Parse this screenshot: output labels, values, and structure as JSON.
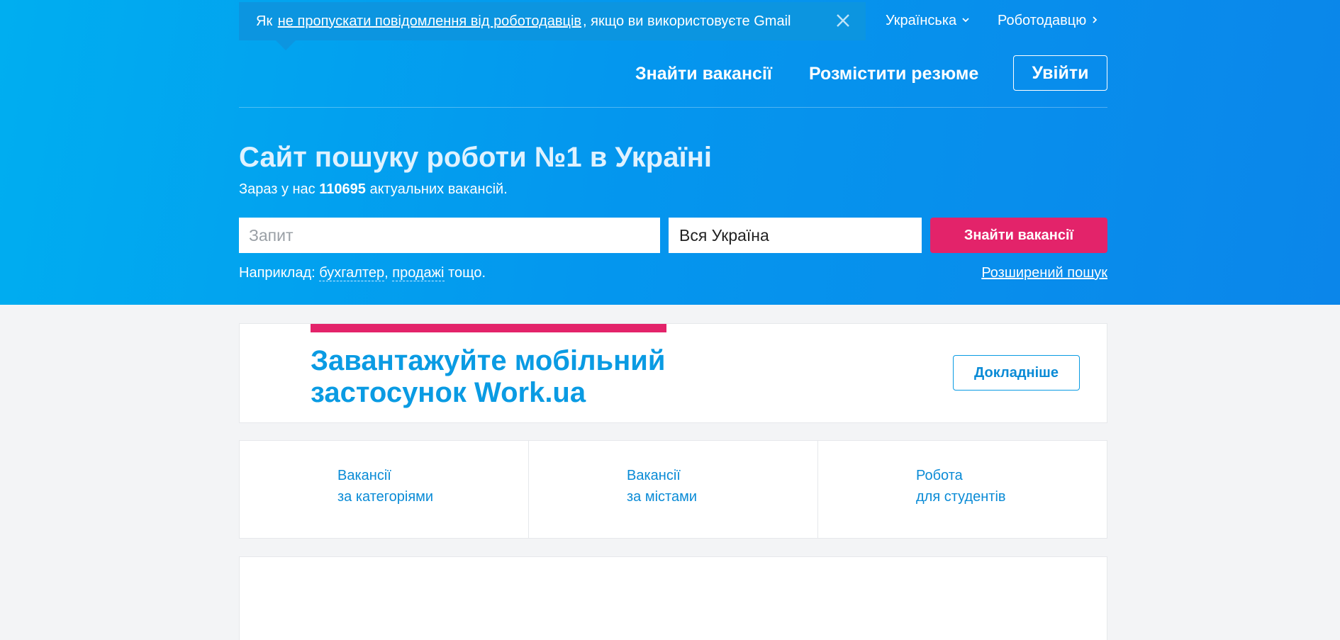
{
  "notice": {
    "prefix": "Як",
    "link": "не пропускати повідомлення від роботодавців",
    "suffix": ", якщо ви використовуєте Gmail"
  },
  "header": {
    "language": "Українська",
    "employer": "Роботодавцю",
    "nav": {
      "find_jobs": "Знайти вакансії",
      "post_resume": "Розмістити резюме",
      "login": "Увійти"
    }
  },
  "hero": {
    "title": "Сайт пошуку роботи №1 в Україні",
    "subtitle_prefix": "Зараз у нас",
    "vacancy_count": "110695",
    "subtitle_suffix": "актуальних вакансій."
  },
  "search": {
    "query_placeholder": "Запит",
    "region_value": "Вся Україна",
    "button": "Знайти вакансії",
    "examples_prefix": "Наприклад:",
    "example1": "бухгалтер",
    "example2": "продажі",
    "examples_suffix": "тощо.",
    "advanced": "Розширений пошук"
  },
  "promo": {
    "title": "Завантажуйте мобільний застосунок Work.ua",
    "button": "Докладніше"
  },
  "categories": [
    {
      "line1": "Вакансії",
      "line2": "за категоріями"
    },
    {
      "line1": "Вакансії",
      "line2": "за містами"
    },
    {
      "line1": "Робота",
      "line2": "для студентів"
    }
  ],
  "colors": {
    "accent": "#e3236a",
    "brand_blue": "#0a9be3",
    "hero_start": "#00aef0",
    "hero_end": "#0b86ea"
  },
  "icons": [
    "close-icon",
    "chevron-down-icon",
    "chevron-right-icon"
  ]
}
